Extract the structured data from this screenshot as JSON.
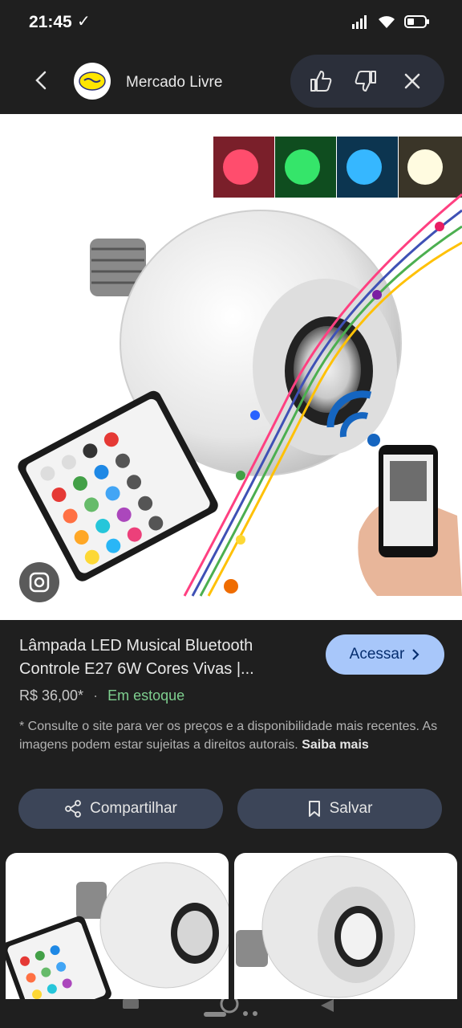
{
  "status_bar": {
    "time": "21:45",
    "sync_icon": "download-done-icon",
    "icons": [
      "signal-icon",
      "wifi-icon",
      "battery-icon"
    ]
  },
  "header": {
    "site_name": "Mercado Livre",
    "back_icon": "back-arrow-icon",
    "actions": [
      "thumb-up-icon",
      "thumb-down-icon",
      "close-icon"
    ]
  },
  "product": {
    "title": "Lâmpada LED Musical Bluetooth Controle E27 6W Cores Vivas |...",
    "price": "R$ 36,00*",
    "separator": "·",
    "stock": "Em estoque",
    "access_label": "Acessar",
    "disclaimer": "* Consulte o site para ver os preços e a disponibilidade mais recentes. As imagens podem estar sujeitas a direitos autorais.",
    "disclaimer_more": "Saiba mais"
  },
  "buttons": {
    "share_label": "Compartilhar",
    "save_label": "Salvar"
  },
  "colors": {
    "accent": "#a8c7fa",
    "pill_bg": "#3c4558",
    "stock_green": "#7ecf8f",
    "bg": "#1f1f1f"
  }
}
